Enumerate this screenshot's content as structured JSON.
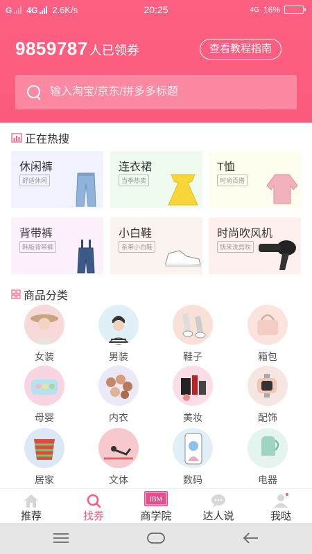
{
  "status_bar": {
    "carrier_1": "G",
    "carrier_2": "4G",
    "speed": "2.6K/s",
    "time": "20:25",
    "network": "4G",
    "battery": "16%",
    "battery_level": 0.16
  },
  "header": {
    "coupon_count": "9859787",
    "coupon_label": "人已领券",
    "guide_button": "查看教程指南"
  },
  "search": {
    "placeholder": "输入淘宝/京东/拼多多标题"
  },
  "hot_search": {
    "title": "正在热搜",
    "items": [
      {
        "name": "休闲裤",
        "tag": "舒适休闲",
        "bg": "#f0f3ff",
        "icon": "jeans-image"
      },
      {
        "name": "连衣裙",
        "tag": "当季热卖",
        "bg": "#f0fbef",
        "icon": "dress-image"
      },
      {
        "name": "T恤",
        "tag": "时尚百搭",
        "bg": "#fffdee",
        "icon": "shirt-image"
      },
      {
        "name": "背带裤",
        "tag": "韩版背带裤",
        "bg": "#fbf0fb",
        "icon": "overalls-image"
      },
      {
        "name": "小白鞋",
        "tag": "系带小白鞋",
        "bg": "#fbf3f0",
        "icon": "sneaker-image"
      },
      {
        "name": "时尚吹风机",
        "tag": "快来洗剪吹",
        "bg": "#fff0f0",
        "icon": "hairdryer-image"
      }
    ]
  },
  "categories": {
    "title": "商品分类",
    "items": [
      {
        "label": "女装",
        "bg": "#f7d9d9",
        "icon": "womens-clothing-image"
      },
      {
        "label": "男装",
        "bg": "#dff1f7",
        "icon": "mens-clothing-image"
      },
      {
        "label": "鞋子",
        "bg": "#f9e1d8",
        "icon": "shoes-image"
      },
      {
        "label": "箱包",
        "bg": "#fbe4dd",
        "icon": "bags-image"
      },
      {
        "label": "母婴",
        "bg": "#f9d5e3",
        "icon": "baby-image"
      },
      {
        "label": "内衣",
        "bg": "#ebe8f7",
        "icon": "underwear-image"
      },
      {
        "label": "美妆",
        "bg": "#fadde6",
        "icon": "makeup-image"
      },
      {
        "label": "配饰",
        "bg": "#f6e6e1",
        "icon": "accessories-image"
      },
      {
        "label": "居家",
        "bg": "#dbe9f7",
        "icon": "home-image"
      },
      {
        "label": "文体",
        "bg": "#f7c9cd",
        "icon": "sports-image"
      },
      {
        "label": "数码",
        "bg": "#e1f0f7",
        "icon": "digital-image"
      },
      {
        "label": "电器",
        "bg": "#e4f4ee",
        "icon": "appliance-image"
      }
    ]
  },
  "bottom_nav": {
    "items": [
      {
        "label": "推荐",
        "icon": "home-icon",
        "active": false
      },
      {
        "label": "找券",
        "icon": "search-icon",
        "active": true
      },
      {
        "label": "商学院",
        "icon": "ibm-book-icon",
        "badge_text": "IBM",
        "active": false
      },
      {
        "label": "达人说",
        "icon": "chat-icon",
        "active": false
      },
      {
        "label": "我哒",
        "icon": "user-icon",
        "active": false
      }
    ]
  },
  "colors": {
    "brand": "#fb5a7d",
    "active_nav": "#fb5a7d"
  }
}
